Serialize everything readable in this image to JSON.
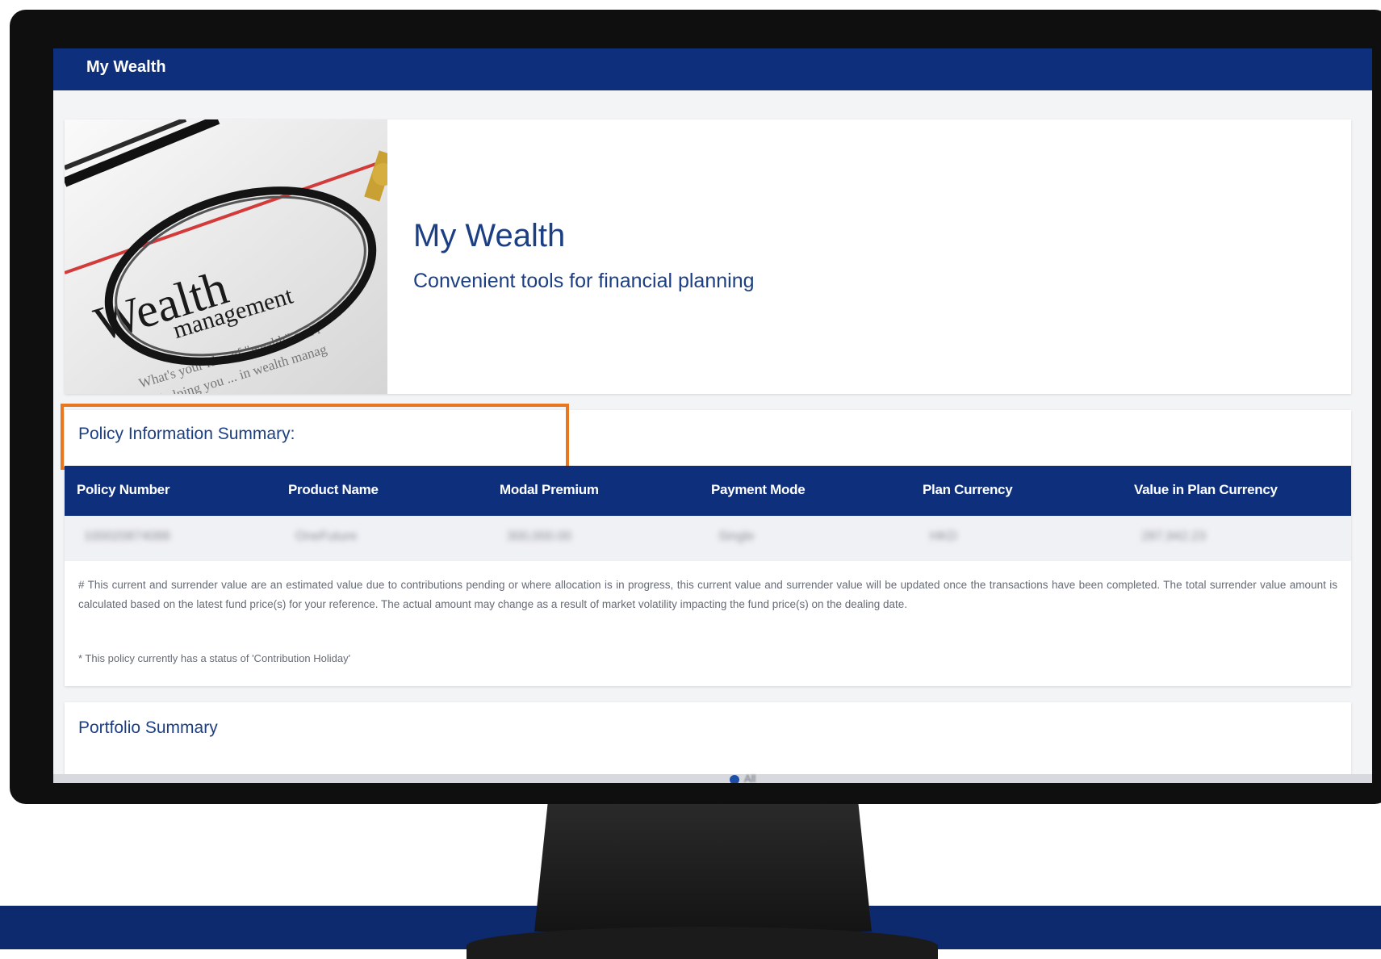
{
  "topbar": {
    "title": "My Wealth"
  },
  "hero": {
    "title": "My Wealth",
    "subtitle": "Convenient tools for financial planning",
    "image": {
      "word_large": "Wealth",
      "word_small": "management",
      "text_line1": "What's your idea of \"wealth\" and r",
      "text_line2": "helping you ... in wealth manag"
    }
  },
  "policy": {
    "title": "Policy Information Summary:",
    "columns": [
      "Policy Number",
      "Product Name",
      "Modal Premium",
      "Payment Mode",
      "Plan Currency",
      "Value in Plan Currency"
    ],
    "row": [
      "100020874088",
      "OneFuture",
      "300,000.00",
      "Single",
      "HKD",
      "287,942.23"
    ],
    "note_hash": "# This current and surrender value are an estimated value due to contributions pending or where allocation is in progress, this current value and surrender value will be updated once the transactions have been completed. The total surrender value amount is calculated based on the latest fund price(s) for your reference. The actual amount may change as a result of market volatility impacting the fund price(s) on the dealing date.",
    "note_star": "* This policy currently has a status of 'Contribution Holiday'"
  },
  "portfolio": {
    "title": "Portfolio Summary",
    "legend_label": "All"
  },
  "colors": {
    "brand_navy": "#0e2f7b",
    "heading_blue": "#1c3f83",
    "highlight_orange": "#e87722"
  }
}
